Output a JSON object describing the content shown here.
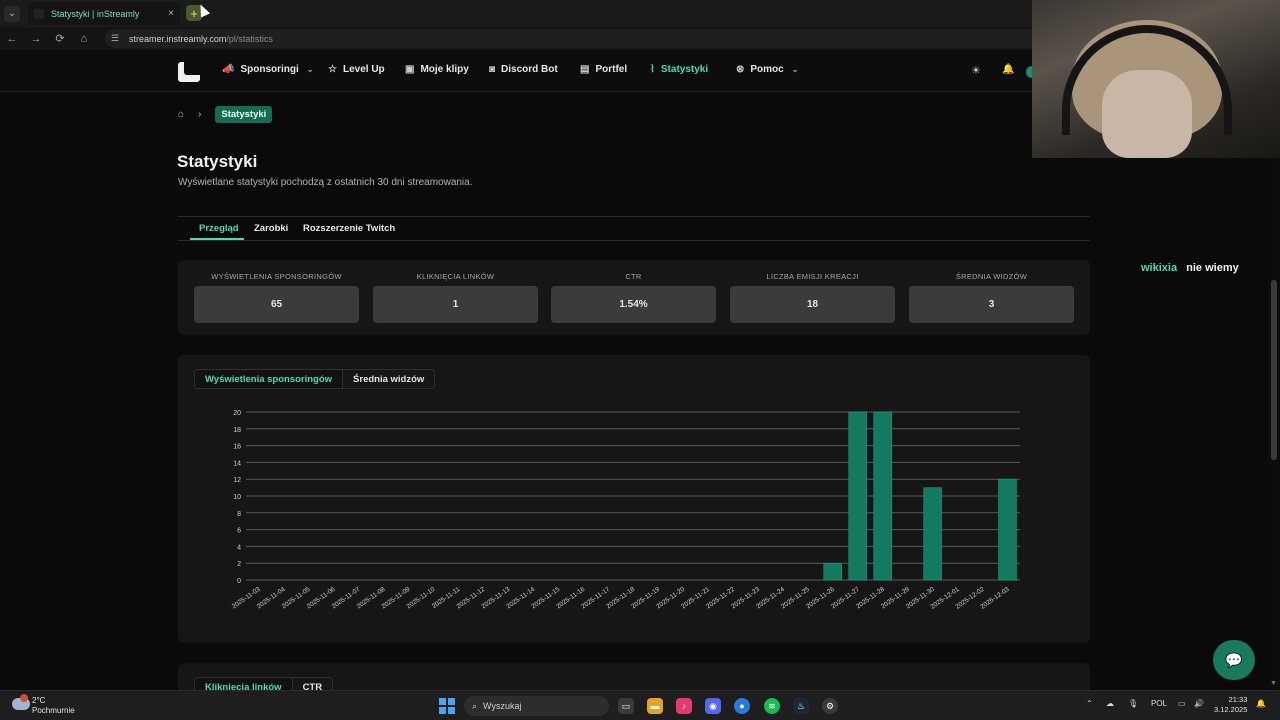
{
  "browser": {
    "tab_title": "Statystyki | inStreamly",
    "tab_close": "×",
    "new_tab": "+",
    "url_host": "streamer.instreamly.com",
    "url_path": "/pl/statistics",
    "back": "←",
    "forward": "→",
    "reload": "⟳",
    "home": "⌂"
  },
  "nav": {
    "items": [
      {
        "label": "Sponsoringi",
        "icon": "megaphone-icon",
        "glyph": "📣"
      },
      {
        "label": "Level Up",
        "icon": "star-icon",
        "glyph": "☆"
      },
      {
        "label": "Moje klipy",
        "icon": "clip-icon",
        "glyph": "▣"
      },
      {
        "label": "Discord Bot",
        "icon": "discord-icon",
        "glyph": "◙"
      },
      {
        "label": "Portfel",
        "icon": "wallet-icon",
        "glyph": "▤"
      },
      {
        "label": "Statystyki",
        "icon": "chart-icon",
        "glyph": "⌇"
      },
      {
        "label": "Pomoc",
        "icon": "help-icon",
        "glyph": "⊗"
      }
    ],
    "theme_glyph": "☀",
    "bell_glyph": "🔔"
  },
  "breadcrumb": {
    "home_glyph": "⌂",
    "sep": "›",
    "current": "Statystyki"
  },
  "page": {
    "title": "Statystyki",
    "subtitle": "Wyświetlane statystyki pochodzą z ostatnich 30 dni streamowania."
  },
  "tabs": [
    "Przegląd",
    "Zarobki",
    "Rozszerzenie Twitch"
  ],
  "stats": [
    {
      "label": "WYŚWIETLENIA SPONSORINGÓW",
      "value": "65"
    },
    {
      "label": "KLIKNIĘCIA LINKÓW",
      "value": "1"
    },
    {
      "label": "CTR",
      "value": "1.54%"
    },
    {
      "label": "LICZBA EMISJI KREACJI",
      "value": "18"
    },
    {
      "label": "ŚREDNIA WIDZÓW",
      "value": "3"
    }
  ],
  "chart_toggle": [
    "Wyświetlenia sponsoringów",
    "Średnia widzów"
  ],
  "chart2_toggle": [
    "Kliknięcia linków",
    "CTR"
  ],
  "chart_data": {
    "type": "bar",
    "ylim": [
      0,
      20
    ],
    "yticks": [
      0,
      2,
      4,
      6,
      8,
      10,
      12,
      14,
      16,
      18,
      20
    ],
    "grid": true,
    "bar_color": "#137a62",
    "categories": [
      "2025-11-03",
      "2025-11-04",
      "2025-11-05",
      "2025-11-06",
      "2025-11-07",
      "2025-11-08",
      "2025-11-09",
      "2025-11-10",
      "2025-11-11",
      "2025-11-12",
      "2025-11-13",
      "2025-11-14",
      "2025-11-15",
      "2025-11-16",
      "2025-11-17",
      "2025-11-18",
      "2025-11-19",
      "2025-11-20",
      "2025-11-21",
      "2025-11-22",
      "2025-11-23",
      "2025-11-24",
      "2025-11-25",
      "2025-11-26",
      "2025-11-27",
      "2025-11-28",
      "2025-11-29",
      "2025-11-30",
      "2025-12-01",
      "2025-12-02",
      "2025-12-03"
    ],
    "values": [
      0,
      0,
      0,
      0,
      0,
      0,
      0,
      0,
      0,
      0,
      0,
      0,
      0,
      0,
      0,
      0,
      0,
      0,
      0,
      0,
      0,
      0,
      0,
      2,
      20,
      20,
      0,
      11,
      0,
      0,
      12
    ]
  },
  "side_chat": {
    "user": "wikixia",
    "message": "nie wiemy"
  },
  "taskbar": {
    "temp": "2°C",
    "weather": "Pochmurnie",
    "search": "Wyszukaj",
    "lang": "POL",
    "time": "21:33",
    "date": "3.12.2025"
  },
  "colors": {
    "accent": "#4fdab0",
    "bar": "#137a62"
  }
}
